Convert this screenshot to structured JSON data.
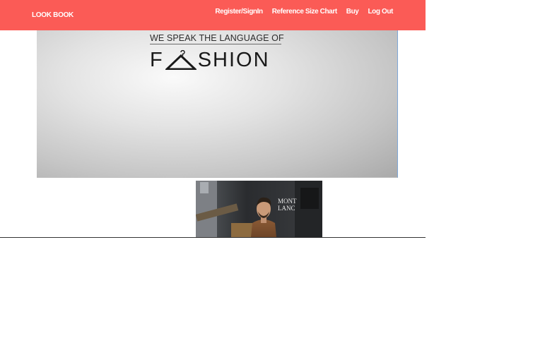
{
  "navbar": {
    "brand": "LOOK BOOK",
    "links": [
      {
        "label": "Register/SignIn"
      },
      {
        "label": "Reference Size Chart"
      },
      {
        "label": "Buy"
      },
      {
        "label": "Log Out"
      }
    ],
    "color": "#fb5b56"
  },
  "hero": {
    "tagline": "WE SPEAK THE LANGUAGE OF",
    "wordmark_prefix": "F",
    "wordmark_suffix": "SHION",
    "wordmark_icon": "hanger-icon"
  },
  "photo": {
    "sign_text": [
      "MONT",
      "LANC"
    ],
    "icon": "man-street-photo"
  }
}
